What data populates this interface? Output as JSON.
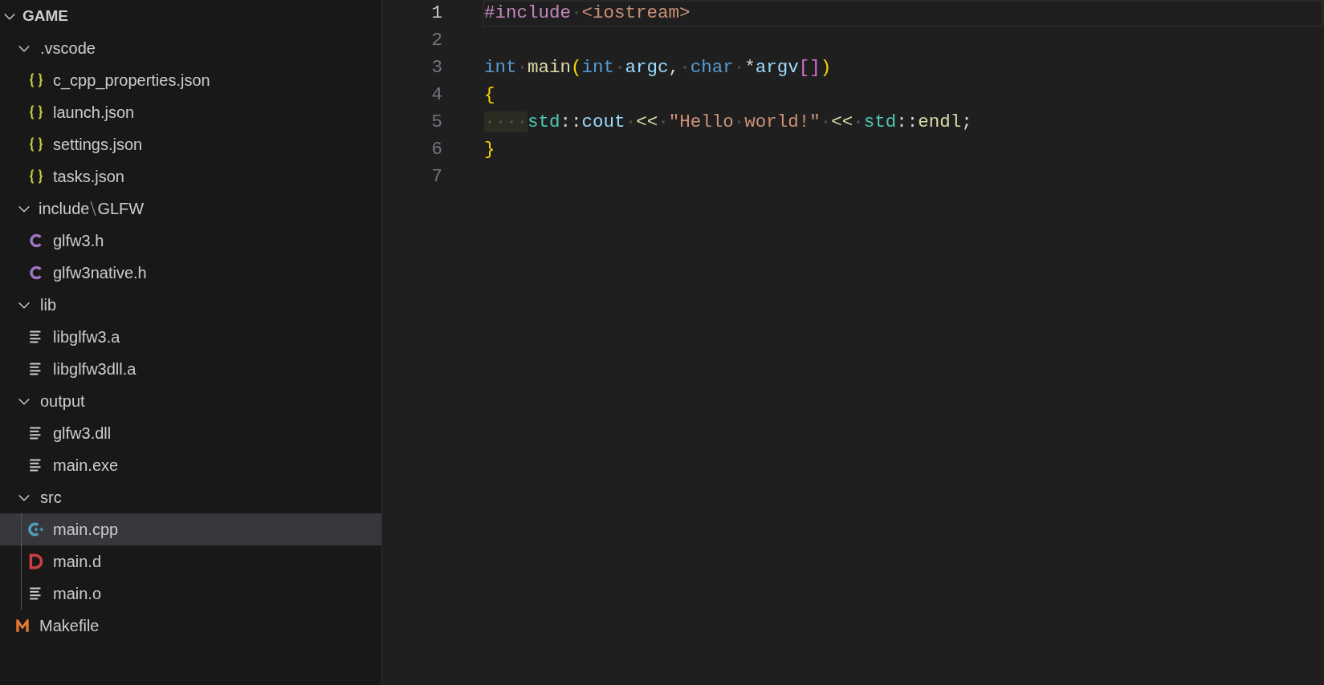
{
  "explorer": {
    "root": {
      "label": "GAME",
      "expanded": true,
      "children": [
        {
          "kind": "folder",
          "label": ".vscode",
          "expanded": true,
          "selected": false,
          "children": [
            {
              "kind": "json",
              "label": "c_cpp_properties.json",
              "selected": false
            },
            {
              "kind": "json",
              "label": "launch.json",
              "selected": false
            },
            {
              "kind": "json",
              "label": "settings.json",
              "selected": false
            },
            {
              "kind": "json",
              "label": "tasks.json",
              "selected": false
            }
          ]
        },
        {
          "kind": "folder",
          "label": "include",
          "label_2": "GLFW",
          "expanded": true,
          "selected": false,
          "children": [
            {
              "kind": "c",
              "label": "glfw3.h",
              "selected": false
            },
            {
              "kind": "c",
              "label": "glfw3native.h",
              "selected": false
            }
          ]
        },
        {
          "kind": "folder",
          "label": "lib",
          "expanded": true,
          "selected": false,
          "children": [
            {
              "kind": "text",
              "label": "libglfw3.a",
              "selected": false
            },
            {
              "kind": "text",
              "label": "libglfw3dll.a",
              "selected": false
            }
          ]
        },
        {
          "kind": "folder",
          "label": "output",
          "expanded": true,
          "selected": false,
          "children": [
            {
              "kind": "text",
              "label": "glfw3.dll",
              "selected": false
            },
            {
              "kind": "text",
              "label": "main.exe",
              "selected": false
            }
          ]
        },
        {
          "kind": "folder",
          "label": "src",
          "expanded": true,
          "selected": false,
          "children": [
            {
              "kind": "cpp",
              "label": "main.cpp",
              "selected": true
            },
            {
              "kind": "d",
              "label": "main.d",
              "selected": false
            },
            {
              "kind": "text",
              "label": "main.o",
              "selected": false
            }
          ]
        },
        {
          "kind": "makefile",
          "label": "Makefile",
          "selected": false
        }
      ]
    }
  },
  "editor": {
    "lines": [
      {
        "number": "1",
        "current": true,
        "tokens": [
          {
            "kind": "preproc",
            "text": "#include "
          },
          {
            "kind": "string",
            "text": "<iostream>"
          }
        ]
      },
      {
        "number": "2",
        "current": false
      },
      {
        "number": "3",
        "current": false,
        "tokens": [
          {
            "kind": "keyword",
            "text": "int "
          },
          {
            "kind": "function",
            "text": "main"
          },
          {
            "kind": "bracket1",
            "text": "("
          },
          {
            "kind": "keyword",
            "text": "int "
          },
          {
            "kind": "variable",
            "text": "argc"
          },
          {
            "kind": "plain",
            "text": ", "
          },
          {
            "kind": "keyword",
            "text": "char "
          },
          {
            "kind": "plain",
            "text": "*"
          },
          {
            "kind": "variable",
            "text": "argv"
          },
          {
            "kind": "bracket2",
            "text": "[]"
          },
          {
            "kind": "bracket1",
            "text": ")"
          }
        ]
      },
      {
        "number": "4",
        "current": false,
        "tokens": [
          {
            "kind": "bracket1",
            "text": "{"
          }
        ]
      },
      {
        "number": "5",
        "current": false,
        "indent_guide": true,
        "tokens": [
          {
            "kind": "namespace",
            "text": "std"
          },
          {
            "kind": "plain",
            "text": "::"
          },
          {
            "kind": "variable",
            "text": "cout "
          },
          {
            "kind": "function",
            "text": "<< "
          },
          {
            "kind": "string",
            "text": "\"Hello world!\" "
          },
          {
            "kind": "function",
            "text": "<< "
          },
          {
            "kind": "namespace",
            "text": "std"
          },
          {
            "kind": "plain",
            "text": "::"
          },
          {
            "kind": "function",
            "text": "endl"
          },
          {
            "kind": "plain",
            "text": ";"
          }
        ]
      },
      {
        "number": "6",
        "current": false,
        "tokens": [
          {
            "kind": "bracket1",
            "text": "}"
          }
        ]
      },
      {
        "number": "7",
        "current": false
      }
    ]
  }
}
